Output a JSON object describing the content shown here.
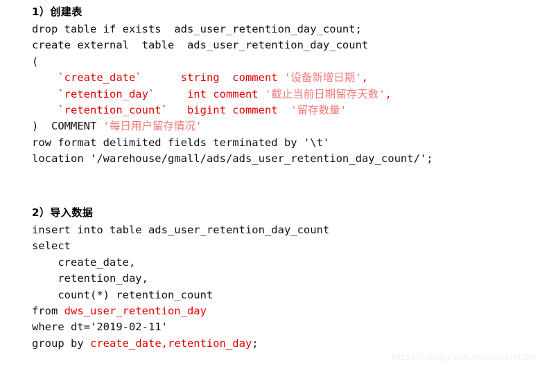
{
  "page": {
    "background": "#ffffff",
    "text_color": "#111111",
    "accent_red": "#e60000",
    "comment_pink": "#f27979",
    "watermark_color": "#eff0f1"
  },
  "watermark": {
    "text": "https://blog.csdn.net/wuxintdrh"
  },
  "sections": [
    {
      "id": "create-table",
      "heading": "1）创建表",
      "lines": [
        {
          "id": "l1",
          "segments": [
            {
              "text": "drop table if exists  ads_user_retention_day_count;",
              "color": "black"
            }
          ]
        },
        {
          "id": "l2",
          "segments": [
            {
              "text": "create external  table  ads_user_retention_day_count",
              "color": "black"
            }
          ]
        },
        {
          "id": "l3",
          "segments": [
            {
              "text": "(",
              "color": "black"
            }
          ]
        },
        {
          "id": "l4",
          "segments": [
            {
              "text": "    `create_date`",
              "color": "red"
            },
            {
              "text": "      string  comment ",
              "color": "red"
            },
            {
              "text": "'设备新增日期'",
              "color": "pink"
            },
            {
              "text": ",",
              "color": "red"
            }
          ]
        },
        {
          "id": "l5",
          "segments": [
            {
              "text": "    `retention_day`",
              "color": "red"
            },
            {
              "text": "     int comment ",
              "color": "red"
            },
            {
              "text": "'截止当前日期留存天数'",
              "color": "pink"
            },
            {
              "text": ",",
              "color": "red"
            }
          ]
        },
        {
          "id": "l6",
          "segments": [
            {
              "text": "    `retention_count`",
              "color": "red"
            },
            {
              "text": "   bigint comment  ",
              "color": "red"
            },
            {
              "text": "'留存数量'",
              "color": "pink"
            }
          ]
        },
        {
          "id": "l7",
          "segments": [
            {
              "text": ")  COMMENT ",
              "color": "black"
            },
            {
              "text": "'每日用户留存情况'",
              "color": "pink"
            }
          ]
        },
        {
          "id": "l8",
          "segments": [
            {
              "text": "row format delimited fields terminated by '\\t'",
              "color": "black"
            }
          ]
        },
        {
          "id": "l9",
          "segments": [
            {
              "text": "location '/warehouse/gmall/ads/ads_user_retention_day_count/';",
              "color": "black"
            }
          ]
        }
      ]
    },
    {
      "id": "insert-data",
      "heading": "2）导入数据",
      "lines": [
        {
          "id": "m1",
          "segments": [
            {
              "text": "insert into table ads_user_retention_day_count",
              "color": "black"
            }
          ]
        },
        {
          "id": "m2",
          "segments": [
            {
              "text": "select",
              "color": "black"
            }
          ]
        },
        {
          "id": "m3",
          "segments": [
            {
              "text": "    create_date,",
              "color": "black"
            }
          ]
        },
        {
          "id": "m4",
          "segments": [
            {
              "text": "    retention_day,",
              "color": "black"
            }
          ]
        },
        {
          "id": "m5",
          "segments": [
            {
              "text": "    count(*) retention_count",
              "color": "black"
            }
          ]
        },
        {
          "id": "m6",
          "segments": [
            {
              "text": "from ",
              "color": "black"
            },
            {
              "text": "dws_user_retention_day",
              "color": "red"
            }
          ]
        },
        {
          "id": "m7",
          "segments": [
            {
              "text": "where dt='2019-02-11'",
              "color": "black"
            }
          ]
        },
        {
          "id": "m8",
          "segments": [
            {
              "text": "group by ",
              "color": "black"
            },
            {
              "text": "create_date,retention_day",
              "color": "red"
            },
            {
              "text": ";",
              "color": "black"
            }
          ]
        }
      ]
    }
  ]
}
